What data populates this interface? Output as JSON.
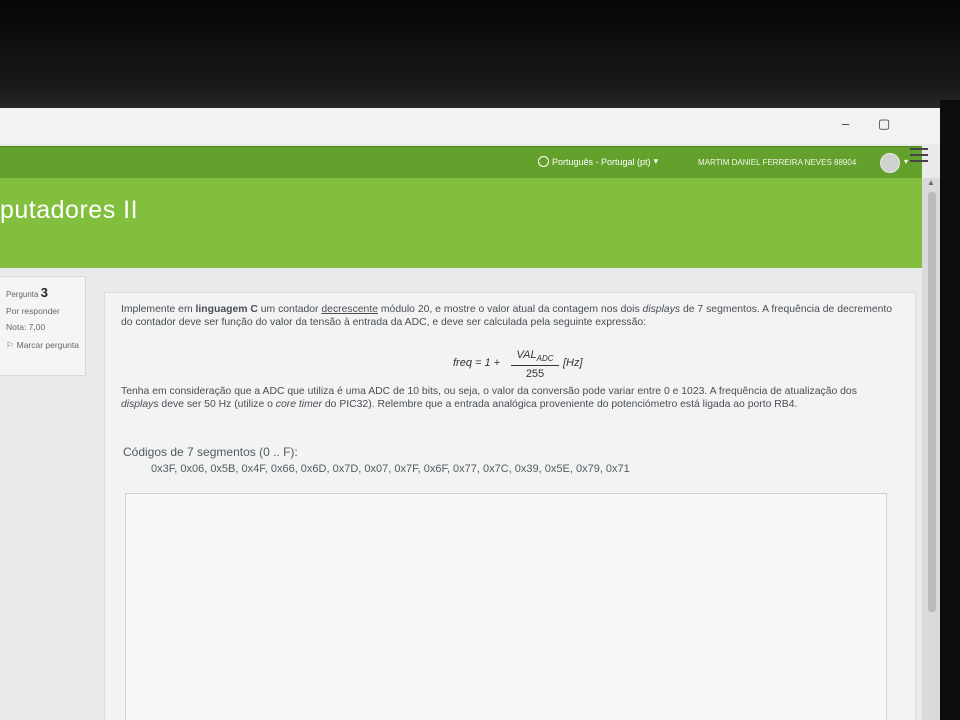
{
  "window": {
    "minimize": "–",
    "maximize": "▢"
  },
  "topbar": {
    "language": "Português - Portugal (pt)",
    "language_caret": "▾",
    "user": "MARTIM DANIEL FERREIRA NEVES 88904",
    "user_caret": "▾"
  },
  "header": {
    "course_title": "putadores II"
  },
  "question_info": {
    "label": "Pergunta",
    "number": "3",
    "status": "Por responder",
    "grade": "Nota: 7,00",
    "flag_label": "Marcar pergunta",
    "flag_icon": "flag-icon"
  },
  "question": {
    "p1_a": "Implemente em ",
    "p1_b": "linguagem C",
    "p1_c": " um contador ",
    "p1_d": "decrescente",
    "p1_e": " módulo 20, e mostre o valor atual da contagem nos dois ",
    "p1_f": "displays",
    "p1_g": " de 7 segmentos. A frequência de decremento do contador deve ser função do valor da tensão à entrada da ADC, e deve ser calculada pela seguinte expressão:",
    "formula": {
      "lhs": "freq = 1 +",
      "numerator": "VAL",
      "numerator_sub": "ADC",
      "denominator": "255",
      "rhs": "[Hz]"
    },
    "p2_a": "Tenha em consideração que a ADC que utiliza é uma ADC de 10 bits, ou seja, o valor da conversão pode variar entre 0 e 1023. A frequência de atualização dos ",
    "p2_b": "displays",
    "p2_c": " deve ser 50 Hz (utilize o ",
    "p2_d": "core timer",
    "p2_e": " do PIC32). Relembre que a entrada analógica proveniente do potenciómetro está ligada ao porto RB4.",
    "codes_title": "Códigos de 7 segmentos (0 .. F):",
    "codes": "0x3F, 0x06, 0x5B, 0x4F, 0x66, 0x6D, 0x7D, 0x07, 0x7F, 0x6F, 0x77, 0x7C, 0x39, 0x5E, 0x79, 0x71"
  },
  "answer": {
    "value": ""
  },
  "colors": {
    "green_bar": "#63a12c",
    "header_green": "#83bf3f"
  }
}
